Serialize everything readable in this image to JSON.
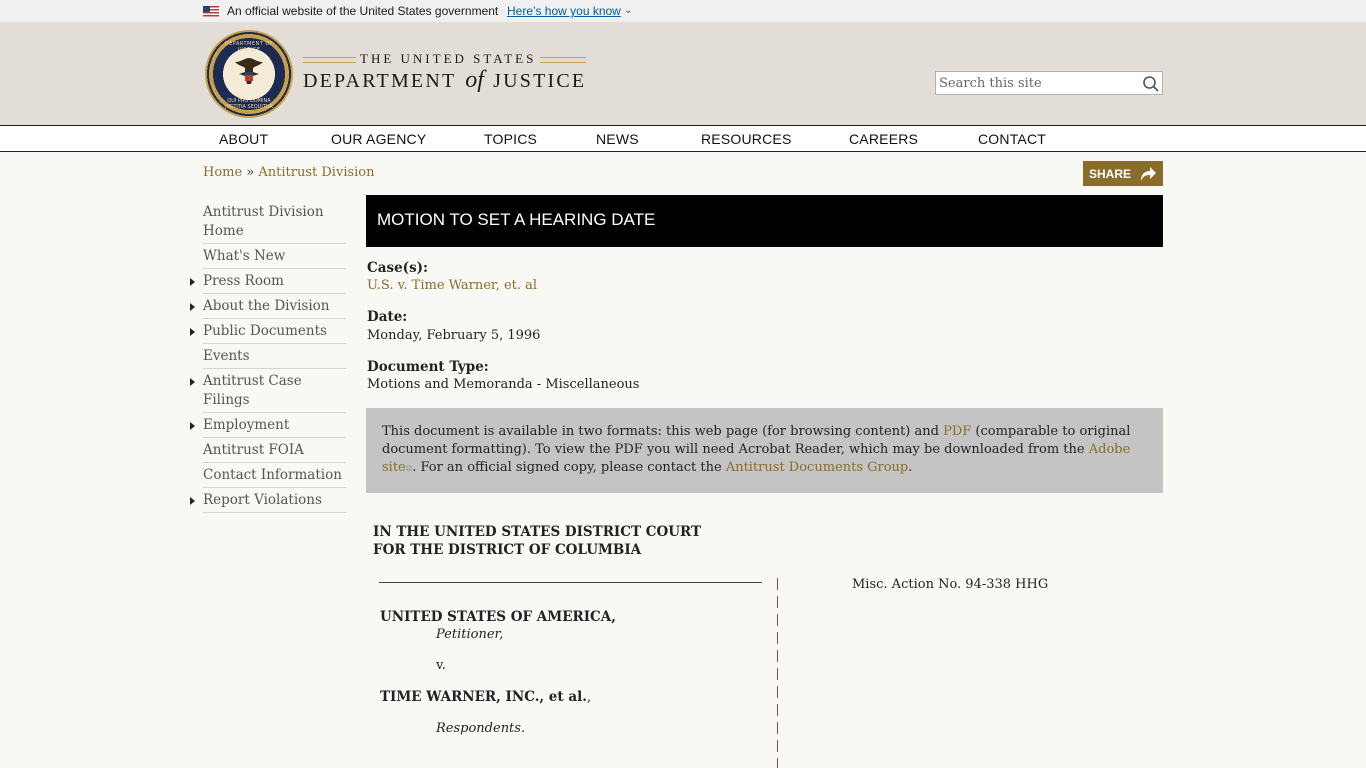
{
  "gov_banner": {
    "official_text": "An official website of the United States government",
    "how_link": "Here’s how you know"
  },
  "header": {
    "brand_top": "THE UNITED STATES",
    "brand_department": "DEPARTMENT",
    "brand_of": "of",
    "brand_justice": "JUSTICE",
    "seal_text_top": "DEPARTMENT OF JUSTICE",
    "seal_text_bottom": "QUI PRO DOMINA JUSTITIA SEQUITUR",
    "search_placeholder": "Search this site"
  },
  "nav": {
    "items": [
      "ABOUT",
      "OUR AGENCY",
      "TOPICS",
      "NEWS",
      "RESOURCES",
      "CAREERS",
      "CONTACT"
    ]
  },
  "breadcrumb": {
    "home": "Home",
    "separator": " » ",
    "current": "Antitrust Division"
  },
  "share_label": "SHARE",
  "sidebar": {
    "items": [
      {
        "label": "Antitrust Division Home",
        "has_children": false
      },
      {
        "label": "What's New",
        "has_children": false
      },
      {
        "label": "Press Room",
        "has_children": true
      },
      {
        "label": "About the Division",
        "has_children": true
      },
      {
        "label": "Public Documents",
        "has_children": true
      },
      {
        "label": "Events",
        "has_children": false
      },
      {
        "label": "Antitrust Case Filings",
        "has_children": true
      },
      {
        "label": "Employment",
        "has_children": true
      },
      {
        "label": "Antitrust FOIA",
        "has_children": false
      },
      {
        "label": "Contact Information",
        "has_children": false
      },
      {
        "label": "Report Violations",
        "has_children": true
      }
    ]
  },
  "document": {
    "title": "MOTION TO SET A HEARING DATE",
    "cases_label": "Case(s):",
    "cases_value": "U.S. v. Time Warner, et. al",
    "date_label": "Date:",
    "date_value": "Monday, February 5, 1996",
    "type_label": "Document Type:",
    "type_value": "Motions and Memoranda - Miscellaneous"
  },
  "notice": {
    "part1": "This document is available in two formats: this web page (for browsing content) and ",
    "pdf_link": "PDF",
    "part2": " (comparable to original document formatting). To view the PDF you will need Acrobat Reader, which may be downloaded from the ",
    "adobe_link": "Adobe site",
    "part3": ". For an official signed copy, please contact the ",
    "group_link": "Antitrust Documents Group",
    "part4": "."
  },
  "court": {
    "line1": "IN THE UNITED STATES DISTRICT COURT",
    "line2": "FOR THE DISTRICT OF COLUMBIA",
    "misc_action": "Misc. Action No. 94-338 HHG",
    "plaintiff": "UNITED STATES OF AMERICA,",
    "plaintiff_role": "Petitioner,",
    "versus": "v.",
    "defendant": "TIME WARNER, INC., et al.",
    "defendant_comma": ",",
    "defendant_role": "Respondents."
  },
  "colors": {
    "link_gold": "#8a6d2b",
    "title_bar": "#000000",
    "header_bg": "#e2ddd6",
    "notice_bg": "#c4c4c4",
    "gov_link": "#005ea2"
  }
}
